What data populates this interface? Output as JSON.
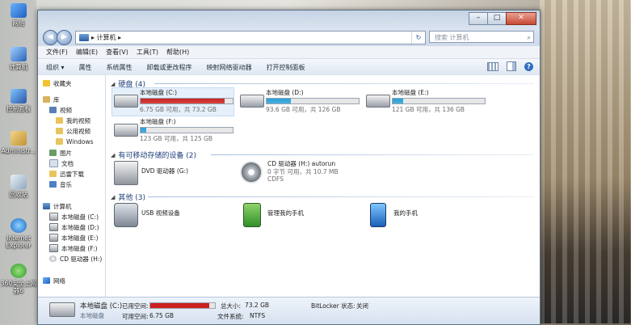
{
  "desktop": {
    "icons": [
      {
        "label": "网络",
        "icon": "network-icon"
      },
      {
        "label": "计算机",
        "icon": "computer-icon"
      },
      {
        "label": "控制面板",
        "icon": "control-panel-icon"
      },
      {
        "label": "Administr...",
        "icon": "user-folder-icon"
      },
      {
        "label": "回收站",
        "icon": "recycle-bin-icon"
      },
      {
        "label": "Internet Explorer",
        "icon": "ie-icon"
      },
      {
        "label": "360安全上网器6",
        "icon": "browser-360-icon"
      }
    ]
  },
  "window": {
    "controls": {
      "minimize": "–",
      "maximize": "□",
      "close": "✕"
    },
    "address": {
      "path": "▸ 计算机 ▸",
      "refresh": "↻"
    },
    "search": {
      "placeholder": "搜索 计算机",
      "icon": "search-icon"
    },
    "menu": [
      "文件(F)",
      "编辑(E)",
      "查看(V)",
      "工具(T)",
      "帮助(H)"
    ],
    "commands": [
      "组织 ▾",
      "属性",
      "系统属性",
      "卸载或更改程序",
      "映射网络驱动器",
      "打开控制面板"
    ],
    "help_label": "?"
  },
  "nav": {
    "favorites": "收藏夹",
    "libraries": "库",
    "lib_items": [
      "视频",
      "我的视频",
      "公用视频",
      "Windows",
      "图片",
      "文档",
      "迅雷下载",
      "音乐"
    ],
    "computer": "计算机",
    "computer_items": [
      "本地磁盘 (C:)",
      "本地磁盘 (D:)",
      "本地磁盘 (E:)",
      "本地磁盘 (F:)",
      "CD 驱动器 (H:)"
    ],
    "network": "网络"
  },
  "groups": {
    "hdd": {
      "title": "硬盘 (4)",
      "drives": [
        {
          "name": "本地磁盘 (C:)",
          "info": "6.75 GB 可用，共 73.2 GB",
          "used": 0.91,
          "color": "#cc1f1f"
        },
        {
          "name": "本地磁盘 (D:)",
          "info": "93.6 GB 可用，共 126 GB",
          "used": 0.26,
          "color": "#26a0da"
        },
        {
          "name": "本地磁盘 (E:)",
          "info": "121 GB 可用，共 136 GB",
          "used": 0.11,
          "color": "#26a0da"
        },
        {
          "name": "本地磁盘 (F:)",
          "info": "123 GB 可用，共 125 GB",
          "used": 0.06,
          "color": "#26a0da"
        }
      ]
    },
    "removable": {
      "title": "有可移动存储的设备 (2)",
      "dvd": {
        "name": "DVD 驱动器 (G:)"
      },
      "cd": {
        "name": "CD 驱动器 (H:) autorun",
        "info1": "0 字节 可用，共 10.7 MB",
        "info2": "CDFS"
      }
    },
    "other": {
      "title": "其他 (3)",
      "items": [
        "USB 视频设备",
        "管理我的手机",
        "我的手机"
      ]
    }
  },
  "details": {
    "name": "本地磁盘 (C:)",
    "type": "本地磁盘",
    "used_label": "已用空间:",
    "free_label": "可用空间:",
    "free_value": "6.75 GB",
    "total_label": "总大小:",
    "total_value": "73.2 GB",
    "fs_label": "文件系统:",
    "fs_value": "NTFS",
    "bitlocker_label": "BitLocker 状态:",
    "bitlocker_value": "关闭",
    "used": 0.91,
    "bar_color": "#cc1f1f"
  }
}
